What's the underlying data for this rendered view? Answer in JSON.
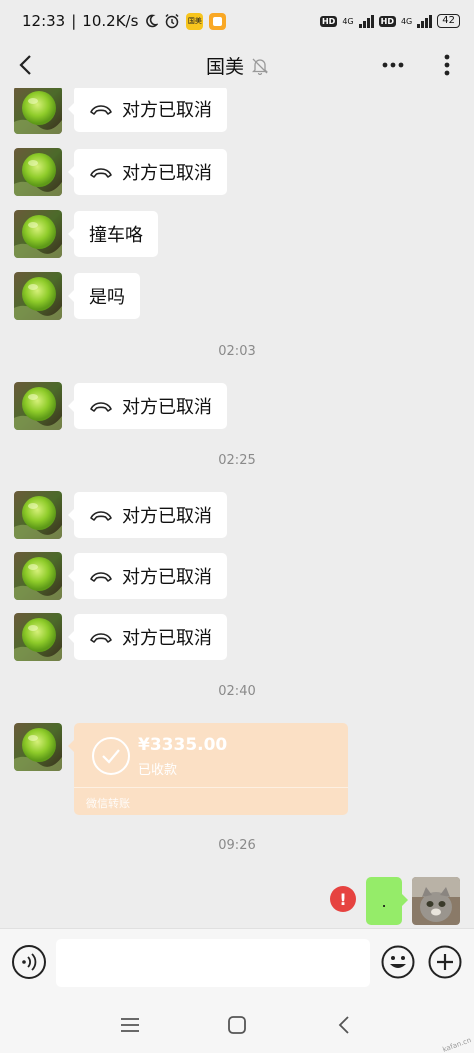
{
  "status_bar": {
    "time": "12:33",
    "network_speed": "10.2K/s",
    "moon_icon": "moon-icon",
    "alarm_icon": "alarm-icon",
    "app_badge_1": "国美",
    "hd_label_1": "HD",
    "signal_label_1": "4G",
    "hd_label_2": "HD",
    "signal_label_2": "4G",
    "battery": "42"
  },
  "header": {
    "title": "国美",
    "mute_icon": "bell-off-icon",
    "more_icon": "more-horizontal-icon",
    "options_icon": "more-vertical-icon",
    "back_icon": "chevron-left-icon"
  },
  "messages": [
    {
      "type": "call",
      "text": "对方已取消"
    },
    {
      "type": "call",
      "text": "对方已取消"
    },
    {
      "type": "text",
      "text": "撞车咯"
    },
    {
      "type": "text",
      "text": "是吗"
    },
    {
      "type": "time",
      "text": "02:03"
    },
    {
      "type": "call",
      "text": "对方已取消"
    },
    {
      "type": "time",
      "text": "02:25"
    },
    {
      "type": "call",
      "text": "对方已取消"
    },
    {
      "type": "call",
      "text": "对方已取消"
    },
    {
      "type": "call",
      "text": "对方已取消"
    },
    {
      "type": "time",
      "text": "02:40"
    },
    {
      "type": "time",
      "text": "09:26"
    }
  ],
  "transfer": {
    "amount": "¥3335.00",
    "status": "已收款",
    "footer": "微信转账",
    "color": "#fbe0c5"
  },
  "sent": {
    "text": ".",
    "error_mark": "!",
    "color": "#95ec69"
  },
  "input_bar": {
    "voice_icon": "voice-icon",
    "placeholder": "",
    "emoji_icon": "emoji-icon",
    "plus_icon": "plus-circle-icon"
  },
  "system_nav": {
    "menu_icon": "menu-icon",
    "home_icon": "home-square-icon",
    "back_icon": "back-triangle-icon"
  },
  "watermark": "kafan.cn"
}
